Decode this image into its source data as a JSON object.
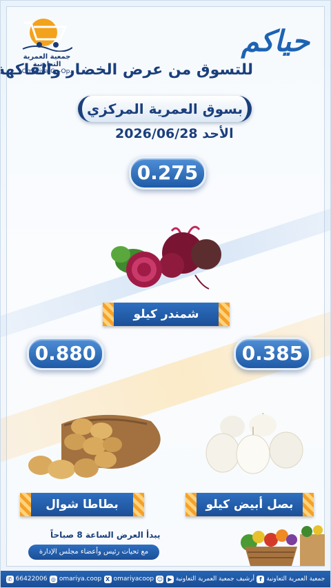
{
  "logo": {
    "arabic": "جمعية العمرية التعاونية",
    "english": "Omariya Co-Op."
  },
  "header": {
    "greeting": "حياكم",
    "subtitle": "للتسوق من عرض الخضار والفاكهة",
    "market": "بسوق العمرية المركزي",
    "date": "الأحد 2026/06/28"
  },
  "products": [
    {
      "name": "شمندر كيلو",
      "price": "0.275",
      "image": "beetroot"
    },
    {
      "name": "بطاطا شوال",
      "price": "0.880",
      "image": "potato-sack"
    },
    {
      "name": "بصل أبيض كيلو",
      "price": "0.385",
      "image": "white-onions"
    }
  ],
  "footer": {
    "start_time": "يبدأ العرض الساعة 8 صباحاً",
    "greetings_note": "مع تحيات رئيس وأعضاء مجلس الإدارة"
  },
  "social": [
    {
      "icon": "whatsapp-icon",
      "glyph": "✆",
      "text": "66422006"
    },
    {
      "icon": "instagram-icon",
      "glyph": "◎",
      "text": "omariya.coop"
    },
    {
      "icon": "x-twitter-icon",
      "glyph": "X",
      "text": "omariyacoop"
    },
    {
      "icon": "snapchat-icon",
      "glyph": "☺",
      "text": ""
    },
    {
      "icon": "youtube-icon",
      "glyph": "▶",
      "text": "أرشيف جمعية العمرية التعاونية"
    },
    {
      "icon": "facebook-icon",
      "glyph": "f",
      "text": "جمعية العمرية التعاونية"
    }
  ],
  "colors": {
    "primary_blue": "#1f5aa6",
    "dark_blue": "#1b3f7c",
    "accent_orange": "#f4a12a"
  }
}
